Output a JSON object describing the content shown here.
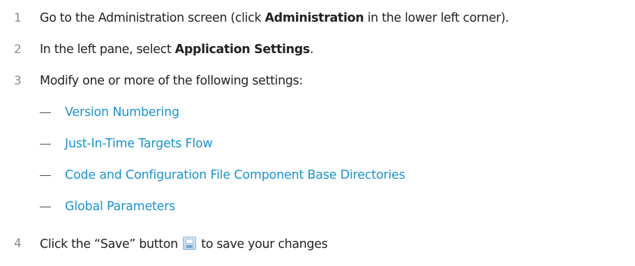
{
  "steps": [
    {
      "number": "1",
      "before": "Go to the Administration screen (click ",
      "bold": "Administration",
      "after": " in the lower left corner)."
    },
    {
      "number": "2",
      "before": "In the left pane, select ",
      "bold": "Application Settings",
      "after": "."
    },
    {
      "number": "3",
      "text": "Modify one or more of the following settings:"
    },
    {
      "number": "4",
      "before": "Click the “Save” button ",
      "icon": "save-icon",
      "after": " to save your changes"
    }
  ],
  "settings_links": [
    "Version Numbering",
    "Just-In-Time Targets Flow",
    "Code and Configuration File Component Base Directories",
    "Global Parameters"
  ],
  "colors": {
    "link": "#1a93cf",
    "step_number": "#8a8a8a",
    "text": "#222222"
  }
}
